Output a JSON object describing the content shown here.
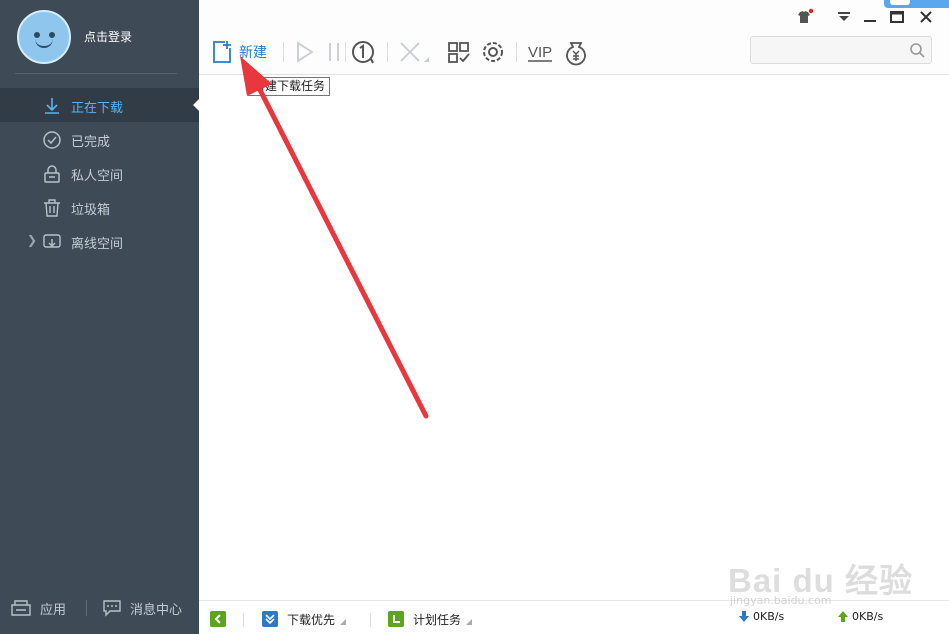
{
  "sidebar": {
    "login_label": "点击登录",
    "items": [
      {
        "label": "正在下载",
        "icon": "download-icon",
        "active": true
      },
      {
        "label": "已完成",
        "icon": "check-circle-icon",
        "active": false
      },
      {
        "label": "私人空间",
        "icon": "lock-icon",
        "active": false
      },
      {
        "label": "垃圾箱",
        "icon": "trash-icon",
        "active": false
      },
      {
        "label": "离线空间",
        "icon": "cloud-download-icon",
        "active": false
      }
    ],
    "bottom": {
      "apps_label": "应用",
      "messages_label": "消息中心"
    }
  },
  "toolbar": {
    "new_label": "新建",
    "tooltip": "新建下载任务",
    "vip_label": "VIP",
    "search_placeholder": ""
  },
  "statusbar": {
    "priority_label": "下载优先",
    "schedule_label": "计划任务",
    "download_speed": "0KB/s",
    "upload_speed": "0KB/s"
  },
  "watermark": {
    "brand": "Bai du 经验",
    "url": "jingyan.baidu.com"
  },
  "colors": {
    "sidebar_bg": "#3e4a55",
    "active_item_bg": "#323c46",
    "accent_blue": "#2b7ac8",
    "annotation_red": "#e8383d",
    "status_green": "#5ca51e"
  }
}
